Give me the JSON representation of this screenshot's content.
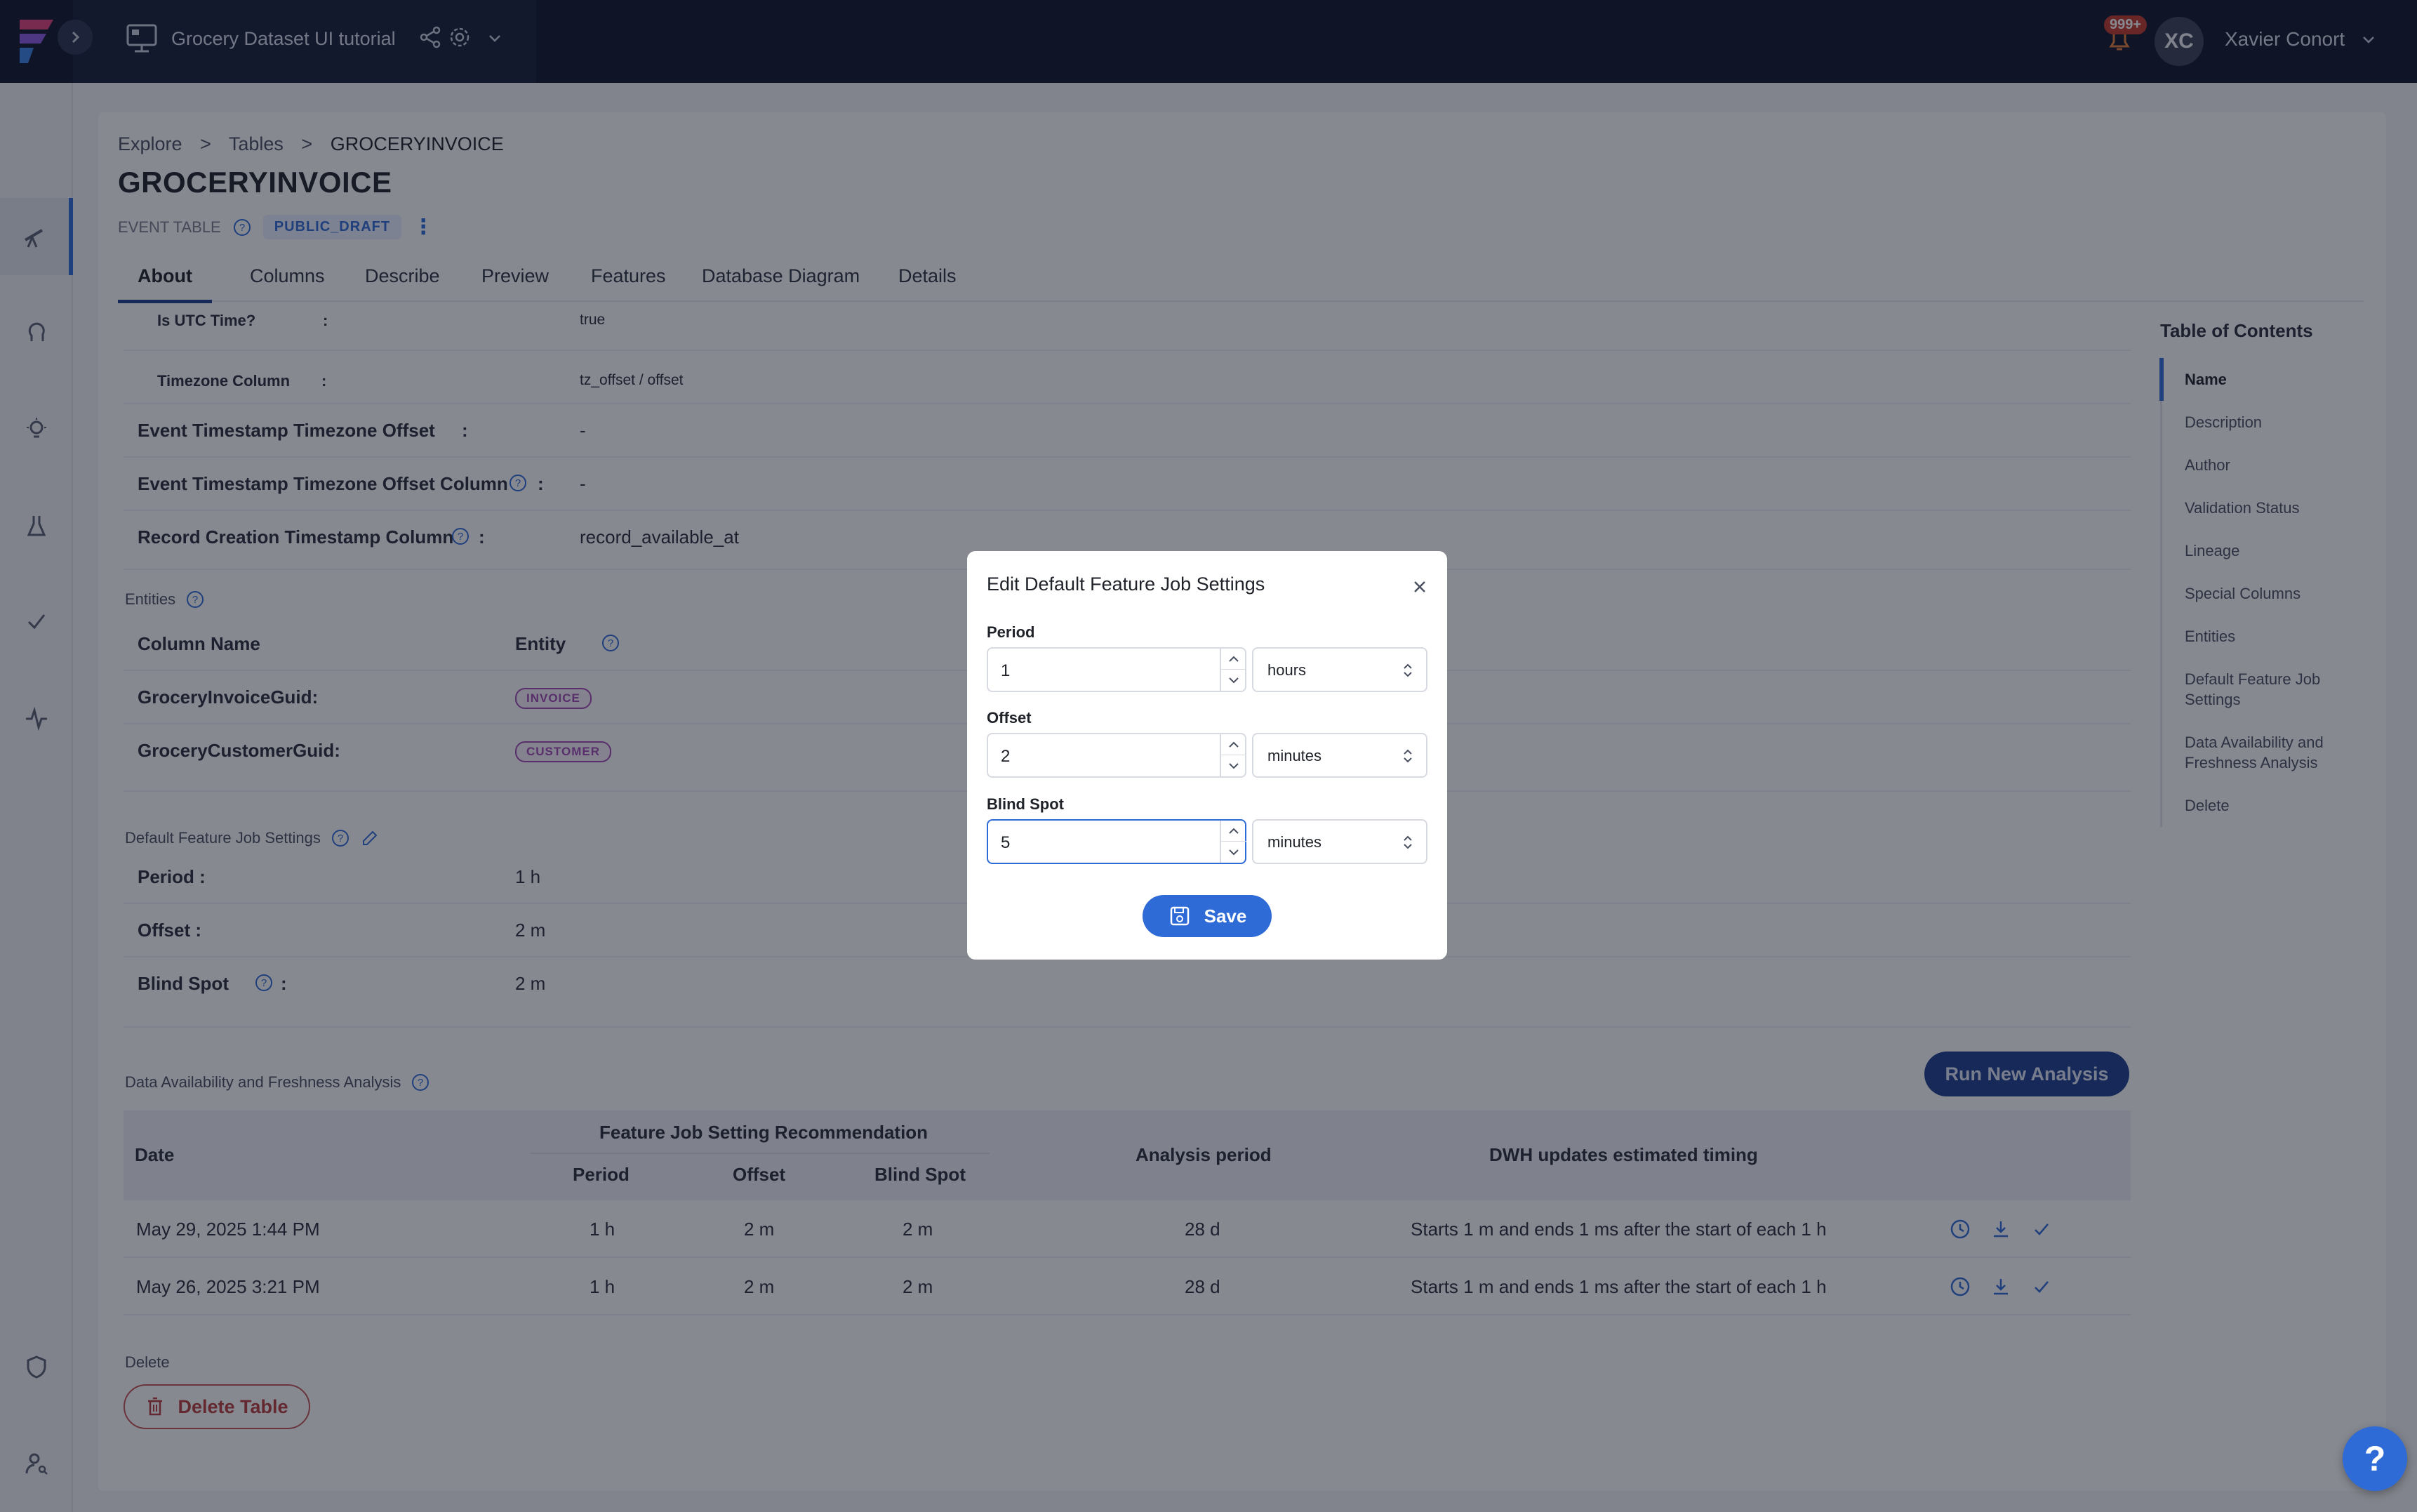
{
  "header": {
    "project_name": "Grocery Dataset UI tutorial",
    "notification_count": "999+",
    "user_initials": "XC",
    "user_name": "Xavier Conort"
  },
  "breadcrumb": [
    "Explore",
    ">",
    "Tables",
    ">",
    "GROCERYINVOICE"
  ],
  "page": {
    "title": "GROCERYINVOICE",
    "table_type": "EVENT TABLE",
    "status_badge": "PUBLIC_DRAFT"
  },
  "tabs": [
    "About",
    "Columns",
    "Describe",
    "Preview",
    "Features",
    "Database Diagram",
    "Details"
  ],
  "special_columns": {
    "is_utc_label": "Is UTC Time?",
    "is_utc_value": "true",
    "tz_col_label": "Timezone Column",
    "tz_col_value": "tz_offset / offset",
    "ts_offset_label": "Event Timestamp Timezone Offset",
    "ts_offset_value": "-",
    "ts_offset_col_label": "Event Timestamp Timezone Offset Column",
    "ts_offset_col_value": "-",
    "record_creation_label": "Record Creation Timestamp Column",
    "record_creation_value": "record_available_at",
    "colon": ":"
  },
  "entities": {
    "section_title": "Entities",
    "col_header": "Column Name",
    "entity_header": "Entity",
    "rows": [
      {
        "column": "GroceryInvoiceGuid:",
        "entity": "INVOICE"
      },
      {
        "column": "GroceryCustomerGuid:",
        "entity": "CUSTOMER"
      }
    ]
  },
  "feature_job": {
    "section_title": "Default Feature Job Settings",
    "period_label": "Period :",
    "period_value": "1 h",
    "offset_label": "Offset :",
    "offset_value": "2 m",
    "blind_label": "Blind Spot",
    "blind_value": "2 m",
    "colon": ":"
  },
  "analysis": {
    "section_title": "Data Availability and Freshness Analysis",
    "run_button": "Run New Analysis",
    "headers": {
      "date": "Date",
      "recommendation": "Feature Job Setting Recommendation",
      "period": "Period",
      "offset": "Offset",
      "blind_spot": "Blind Spot",
      "analysis_period": "Analysis period",
      "dwh": "DWH updates estimated timing"
    },
    "rows": [
      {
        "date": "May 29, 2025 1:44 PM",
        "period": "1 h",
        "offset": "2 m",
        "blind": "2 m",
        "analysis_period": "28 d",
        "dwh": "Starts 1 m and ends 1 ms after the start of each 1 h"
      },
      {
        "date": "May 26, 2025 3:21 PM",
        "period": "1 h",
        "offset": "2 m",
        "blind": "2 m",
        "analysis_period": "28 d",
        "dwh": "Starts 1 m and ends 1 ms after the start of each 1 h"
      }
    ]
  },
  "delete": {
    "section_title": "Delete",
    "button": "Delete Table"
  },
  "toc": {
    "title": "Table of Contents",
    "items": [
      "Name",
      "Description",
      "Author",
      "Validation Status",
      "Lineage",
      "Special Columns",
      "Entities",
      "Default Feature Job Settings",
      "Data Availability and Freshness Analysis",
      "Delete"
    ]
  },
  "modal": {
    "title": "Edit Default Feature Job Settings",
    "period_label": "Period",
    "period_value": "1",
    "period_unit": "hours",
    "offset_label": "Offset",
    "offset_value": "2",
    "offset_unit": "minutes",
    "blind_label": "Blind Spot",
    "blind_value": "5",
    "blind_unit": "minutes",
    "save_label": "Save"
  },
  "help_fab": "?",
  "colors": {
    "topbar": "#0f1729",
    "accent": "#2e6bd6",
    "navy_button": "#1d3f8f",
    "danger": "#b63c3c",
    "entity_tag": "#a04ab3"
  }
}
